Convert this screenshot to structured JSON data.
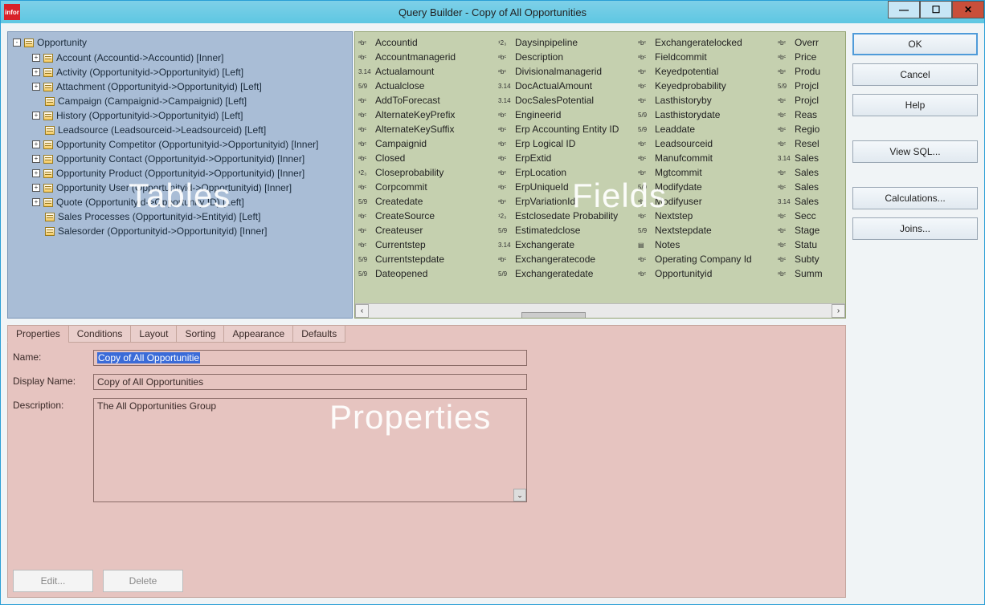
{
  "window": {
    "title": "Query Builder - Copy of All Opportunities",
    "logo_text": "infor"
  },
  "overlays": {
    "tables": "Tables",
    "fields": "Fields",
    "properties": "Properties"
  },
  "tree": {
    "root": "Opportunity",
    "children": [
      {
        "exp": "+",
        "label": "Account (Accountid->Accountid) [Inner]"
      },
      {
        "exp": "+",
        "label": "Activity (Opportunityid->Opportunityid) [Left]"
      },
      {
        "exp": "+",
        "label": "Attachment (Opportunityid->Opportunityid) [Left]"
      },
      {
        "exp": "",
        "label": "Campaign (Campaignid->Campaignid) [Left]"
      },
      {
        "exp": "+",
        "label": "History (Opportunityid->Opportunityid) [Left]"
      },
      {
        "exp": "",
        "label": "Leadsource (Leadsourceid->Leadsourceid) [Left]"
      },
      {
        "exp": "+",
        "label": "Opportunity Competitor (Opportunityid->Opportunityid) [Inner]"
      },
      {
        "exp": "+",
        "label": "Opportunity Contact (Opportunityid->Opportunityid) [Inner]"
      },
      {
        "exp": "+",
        "label": "Opportunity Product (Opportunityid->Opportunityid) [Inner]"
      },
      {
        "exp": "+",
        "label": "Opportunity User (Opportunityid->Opportunityid) [Inner]"
      },
      {
        "exp": "+",
        "label": "Quote (Opportunityid->Opportunity ID) [Left]"
      },
      {
        "exp": "",
        "label": "Sales Processes (Opportunityid->Entityid) [Left]"
      },
      {
        "exp": "",
        "label": "Salesorder (Opportunityid->Opportunityid) [Inner]"
      }
    ]
  },
  "fields": {
    "columns": [
      [
        {
          "t": "abc",
          "n": "Accountid"
        },
        {
          "t": "abc",
          "n": "Accountmanagerid"
        },
        {
          "t": "3.14",
          "n": "Actualamount"
        },
        {
          "t": "5/9",
          "n": "Actualclose"
        },
        {
          "t": "abc",
          "n": "AddToForecast"
        },
        {
          "t": "abc",
          "n": "AlternateKeyPrefix"
        },
        {
          "t": "abc",
          "n": "AlternateKeySuffix"
        },
        {
          "t": "abc",
          "n": "Campaignid"
        },
        {
          "t": "abc",
          "n": "Closed"
        },
        {
          "t": "123",
          "n": "Closeprobability"
        },
        {
          "t": "abc",
          "n": "Corpcommit"
        },
        {
          "t": "5/9",
          "n": "Createdate"
        },
        {
          "t": "abc",
          "n": "CreateSource"
        },
        {
          "t": "abc",
          "n": "Createuser"
        },
        {
          "t": "abc",
          "n": "Currentstep"
        },
        {
          "t": "5/9",
          "n": "Currentstepdate"
        },
        {
          "t": "5/9",
          "n": "Dateopened"
        }
      ],
      [
        {
          "t": "123",
          "n": "Daysinpipeline"
        },
        {
          "t": "abc",
          "n": "Description"
        },
        {
          "t": "abc",
          "n": "Divisionalmanagerid"
        },
        {
          "t": "3.14",
          "n": "DocActualAmount"
        },
        {
          "t": "3.14",
          "n": "DocSalesPotential"
        },
        {
          "t": "abc",
          "n": "Engineerid"
        },
        {
          "t": "abc",
          "n": "Erp Accounting Entity ID"
        },
        {
          "t": "abc",
          "n": "Erp Logical ID"
        },
        {
          "t": "abc",
          "n": "ErpExtid"
        },
        {
          "t": "abc",
          "n": "ErpLocation"
        },
        {
          "t": "abc",
          "n": "ErpUniqueId"
        },
        {
          "t": "abc",
          "n": "ErpVariationId"
        },
        {
          "t": "123",
          "n": "Estclosedate Probability"
        },
        {
          "t": "5/9",
          "n": "Estimatedclose"
        },
        {
          "t": "3.14",
          "n": "Exchangerate"
        },
        {
          "t": "abc",
          "n": "Exchangeratecode"
        },
        {
          "t": "5/9",
          "n": "Exchangeratedate"
        }
      ],
      [
        {
          "t": "abc",
          "n": "Exchangeratelocked"
        },
        {
          "t": "abc",
          "n": "Fieldcommit"
        },
        {
          "t": "abc",
          "n": "Keyedpotential"
        },
        {
          "t": "abc",
          "n": "Keyedprobability"
        },
        {
          "t": "abc",
          "n": "Lasthistoryby"
        },
        {
          "t": "5/9",
          "n": "Lasthistorydate"
        },
        {
          "t": "5/9",
          "n": "Leaddate"
        },
        {
          "t": "abc",
          "n": "Leadsourceid"
        },
        {
          "t": "abc",
          "n": "Manufcommit"
        },
        {
          "t": "abc",
          "n": "Mgtcommit"
        },
        {
          "t": "5/9",
          "n": "Modifydate"
        },
        {
          "t": "abc",
          "n": "Modifyuser"
        },
        {
          "t": "abc",
          "n": "Nextstep"
        },
        {
          "t": "5/9",
          "n": "Nextstepdate"
        },
        {
          "t": "note",
          "n": "Notes"
        },
        {
          "t": "abc",
          "n": "Operating Company Id"
        },
        {
          "t": "abc",
          "n": "Opportunityid"
        }
      ],
      [
        {
          "t": "abc",
          "n": "Overr"
        },
        {
          "t": "abc",
          "n": "Price"
        },
        {
          "t": "abc",
          "n": "Produ"
        },
        {
          "t": "5/9",
          "n": "Projcl"
        },
        {
          "t": "abc",
          "n": "Projcl"
        },
        {
          "t": "abc",
          "n": "Reas"
        },
        {
          "t": "abc",
          "n": "Regio"
        },
        {
          "t": "abc",
          "n": "Resel"
        },
        {
          "t": "3.14",
          "n": "Sales"
        },
        {
          "t": "abc",
          "n": "Sales"
        },
        {
          "t": "abc",
          "n": "Sales"
        },
        {
          "t": "3.14",
          "n": "Sales"
        },
        {
          "t": "abc",
          "n": "Secc"
        },
        {
          "t": "abc",
          "n": "Stage"
        },
        {
          "t": "abc",
          "n": "Statu"
        },
        {
          "t": "abc",
          "n": "Subty"
        },
        {
          "t": "abc",
          "n": "Summ"
        }
      ]
    ]
  },
  "tabs": [
    "Properties",
    "Conditions",
    "Layout",
    "Sorting",
    "Appearance",
    "Defaults"
  ],
  "properties": {
    "name_label": "Name:",
    "name_value": "Copy of All Opportunitie",
    "display_label": "Display Name:",
    "display_value": "Copy of All Opportunities",
    "description_label": "Description:",
    "description_value": "The All Opportunities Group",
    "edit": "Edit...",
    "delete": "Delete"
  },
  "buttons": {
    "ok": "OK",
    "cancel": "Cancel",
    "help": "Help",
    "viewsql": "View SQL...",
    "calculations": "Calculations...",
    "joins": "Joins..."
  },
  "type_glyph": {
    "abc": "ᵃbᶜ",
    "123": "¹2₃",
    "3.14": "3.14",
    "5/9": "5/9",
    "note": "▤"
  }
}
